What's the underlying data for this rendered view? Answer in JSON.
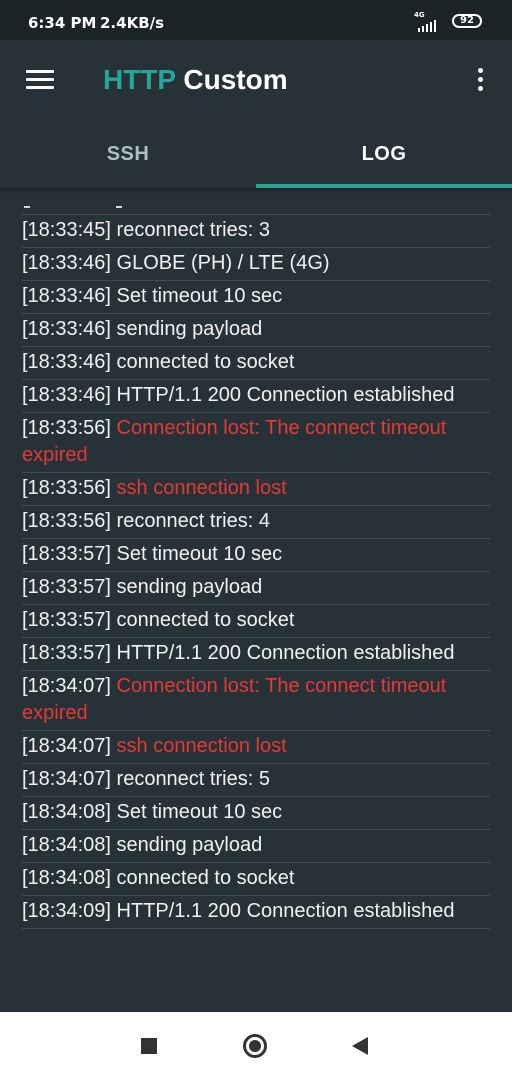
{
  "status_bar": {
    "time": "6:34 PM",
    "speed": "2.4KB/s",
    "network_type": "4G",
    "battery": "92"
  },
  "app_bar": {
    "title_part1": "HTTP",
    "title_part2": "Custom",
    "menu_icon": "hamburger-menu-icon",
    "overflow_icon": "more-vertical-icon",
    "title_accent_color": "#26a69a"
  },
  "tabs": [
    {
      "label": "SSH",
      "selected": false
    },
    {
      "label": "LOG",
      "selected": true
    }
  ],
  "colors": {
    "accent": "#26a69a",
    "background": "#263238",
    "error_text": "#e53935",
    "normal_text": "#f2f2f2"
  },
  "log": [
    {
      "time": "[18:33:45]",
      "message": "reconnect tries: 3",
      "error": false
    },
    {
      "time": "[18:33:46]",
      "message": "GLOBE (PH) / LTE (4G)",
      "error": false
    },
    {
      "time": "[18:33:46]",
      "message": "Set timeout 10 sec",
      "error": false
    },
    {
      "time": "[18:33:46]",
      "message": "sending payload",
      "error": false
    },
    {
      "time": "[18:33:46]",
      "message": "connected to socket",
      "error": false
    },
    {
      "time": "[18:33:46]",
      "message": "HTTP/1.1 200 Connection established",
      "error": false
    },
    {
      "time": "[18:33:56]",
      "message": "Connection lost: The connect timeout expired",
      "error": true
    },
    {
      "time": "[18:33:56]",
      "message": "ssh connection lost",
      "error": true
    },
    {
      "time": "[18:33:56]",
      "message": "reconnect tries: 4",
      "error": false
    },
    {
      "time": "[18:33:57]",
      "message": "Set timeout 10 sec",
      "error": false
    },
    {
      "time": "[18:33:57]",
      "message": "sending payload",
      "error": false
    },
    {
      "time": "[18:33:57]",
      "message": "connected to socket",
      "error": false
    },
    {
      "time": "[18:33:57]",
      "message": "HTTP/1.1 200 Connection established",
      "error": false
    },
    {
      "time": "[18:34:07]",
      "message": "Connection lost: The connect timeout expired",
      "error": true
    },
    {
      "time": "[18:34:07]",
      "message": "ssh connection lost",
      "error": true
    },
    {
      "time": "[18:34:07]",
      "message": "reconnect tries: 5",
      "error": false
    },
    {
      "time": "[18:34:08]",
      "message": "Set timeout 10 sec",
      "error": false
    },
    {
      "time": "[18:34:08]",
      "message": "sending payload",
      "error": false
    },
    {
      "time": "[18:34:08]",
      "message": "connected to socket",
      "error": false
    },
    {
      "time": "[18:34:09]",
      "message": "HTTP/1.1 200 Connection established",
      "error": false
    }
  ],
  "nav_bar": {
    "recents_icon": "square-recents-icon",
    "home_icon": "circle-home-icon",
    "back_icon": "triangle-back-icon"
  }
}
